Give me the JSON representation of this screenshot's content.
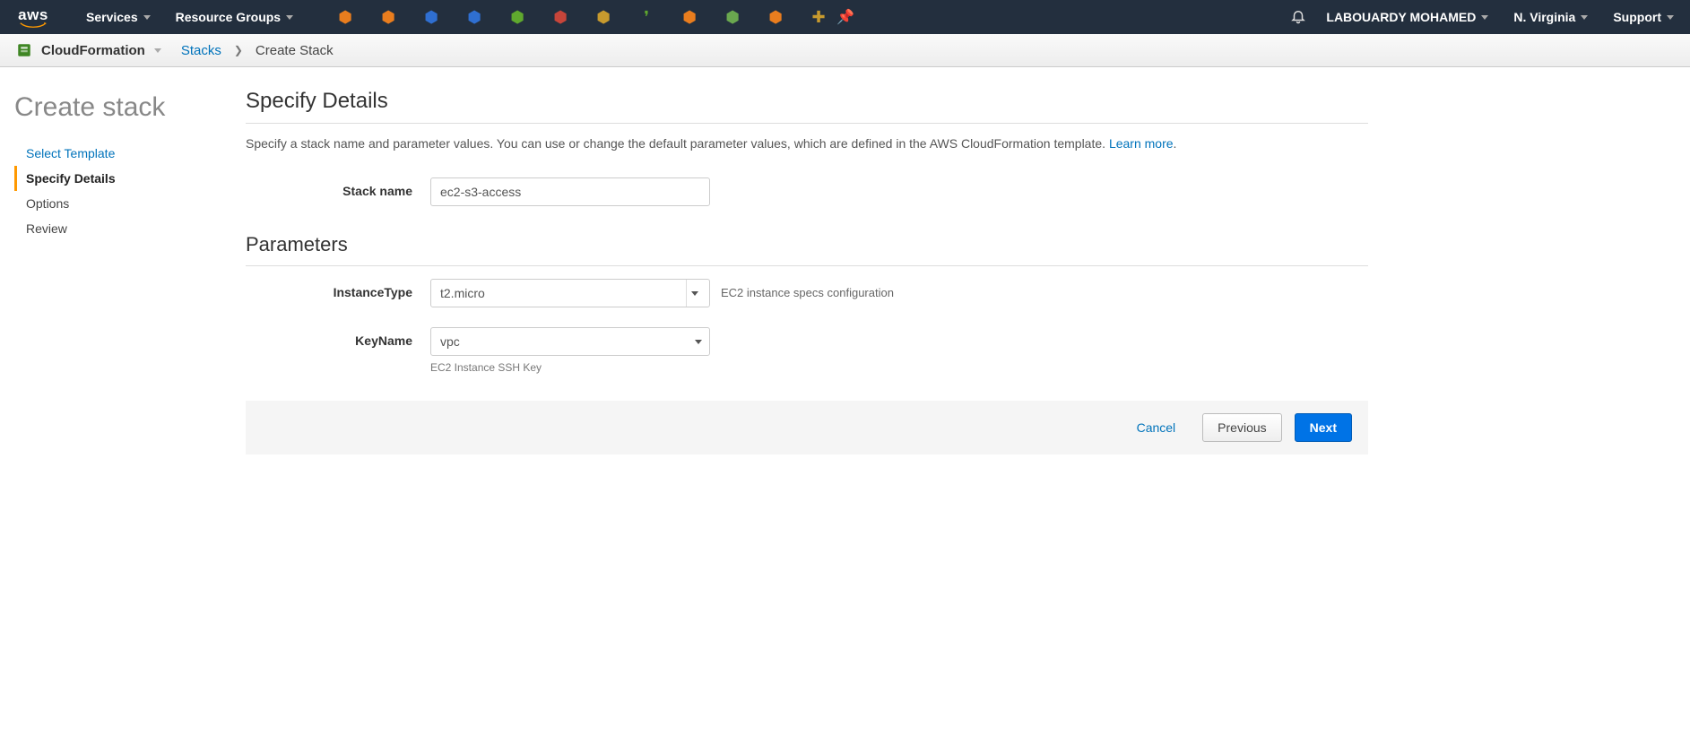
{
  "topnav": {
    "services": "Services",
    "resource_groups": "Resource Groups",
    "user": "LABOUARDY MOHAMED",
    "region": "N. Virginia",
    "support": "Support",
    "service_icons": [
      {
        "name": "svc-icon-1",
        "glyph": "⬢",
        "color": "#e97d1e"
      },
      {
        "name": "svc-icon-2",
        "glyph": "⬢",
        "color": "#e97d1e"
      },
      {
        "name": "svc-icon-3",
        "glyph": "⬢",
        "color": "#2f6fd1"
      },
      {
        "name": "svc-icon-4",
        "glyph": "⬢",
        "color": "#2f6fd1"
      },
      {
        "name": "svc-icon-5",
        "glyph": "⬢",
        "color": "#5fa82e"
      },
      {
        "name": "svc-icon-6",
        "glyph": "⬢",
        "color": "#c7453a"
      },
      {
        "name": "svc-icon-7",
        "glyph": "⬢",
        "color": "#c79a2e"
      },
      {
        "name": "svc-icon-8",
        "glyph": "❜",
        "color": "#5fa82e"
      },
      {
        "name": "svc-icon-9",
        "glyph": "⬢",
        "color": "#e97d1e"
      },
      {
        "name": "svc-icon-10",
        "glyph": "⬢",
        "color": "#6aa84f"
      },
      {
        "name": "svc-icon-11",
        "glyph": "⬢",
        "color": "#e97d1e"
      },
      {
        "name": "svc-icon-12",
        "glyph": "✚",
        "color": "#c79a2e"
      }
    ]
  },
  "breadcrumb": {
    "service": "CloudFormation",
    "stacks": "Stacks",
    "current": "Create Stack"
  },
  "page_title": "Create stack",
  "wizard": {
    "select_template": "Select Template",
    "specify_details": "Specify Details",
    "options": "Options",
    "review": "Review"
  },
  "details": {
    "heading": "Specify Details",
    "intro_pre": "Specify a stack name and parameter values. You can use or change the default parameter values, which are defined in the AWS CloudFormation template. ",
    "learn_more": "Learn more",
    "intro_suffix": ".",
    "stack_name_label": "Stack name",
    "stack_name_value": "ec2-s3-access"
  },
  "params": {
    "heading": "Parameters",
    "instance_type_label": "InstanceType",
    "instance_type_value": "t2.micro",
    "instance_type_desc": "EC2 instance specs configuration",
    "key_name_label": "KeyName",
    "key_name_value": "vpc",
    "key_name_help": "EC2 Instance SSH Key"
  },
  "footer": {
    "cancel": "Cancel",
    "previous": "Previous",
    "next": "Next"
  }
}
